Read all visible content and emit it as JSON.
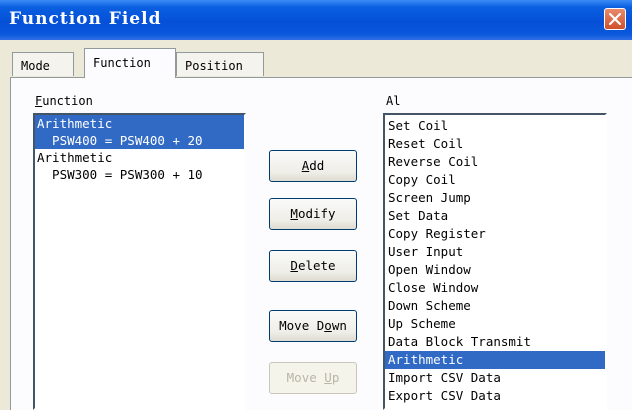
{
  "window": {
    "title": "Function Field"
  },
  "tabs": [
    "Mode",
    "Function",
    "Position"
  ],
  "function_group": {
    "label": "Function",
    "items": [
      {
        "name": "Arithmetic",
        "detail": "PSW400 = PSW400 + 20",
        "selected": true
      },
      {
        "name": "Arithmetic",
        "detail": "PSW300 = PSW300 + 10",
        "selected": false
      }
    ]
  },
  "buttons": {
    "add": "Add",
    "modify": "Modify",
    "delete": "Delete",
    "move_down": "Move Down",
    "move_up": "Move Up"
  },
  "action_group": {
    "label": "Al",
    "items": [
      "Set Coil",
      "Reset Coil",
      "Reverse Coil",
      "Copy Coil",
      "Screen Jump",
      "Set Data",
      "Copy Register",
      "User Input",
      "Open Window",
      "Close Window",
      "Down Scheme",
      "Up Scheme",
      "Data Block Transmit",
      "Arithmetic",
      "Import CSV Data",
      "Export CSV Data"
    ],
    "selected": "Arithmetic"
  },
  "colors": {
    "selection": "#316ac5",
    "title_bar": "#0550d8"
  }
}
